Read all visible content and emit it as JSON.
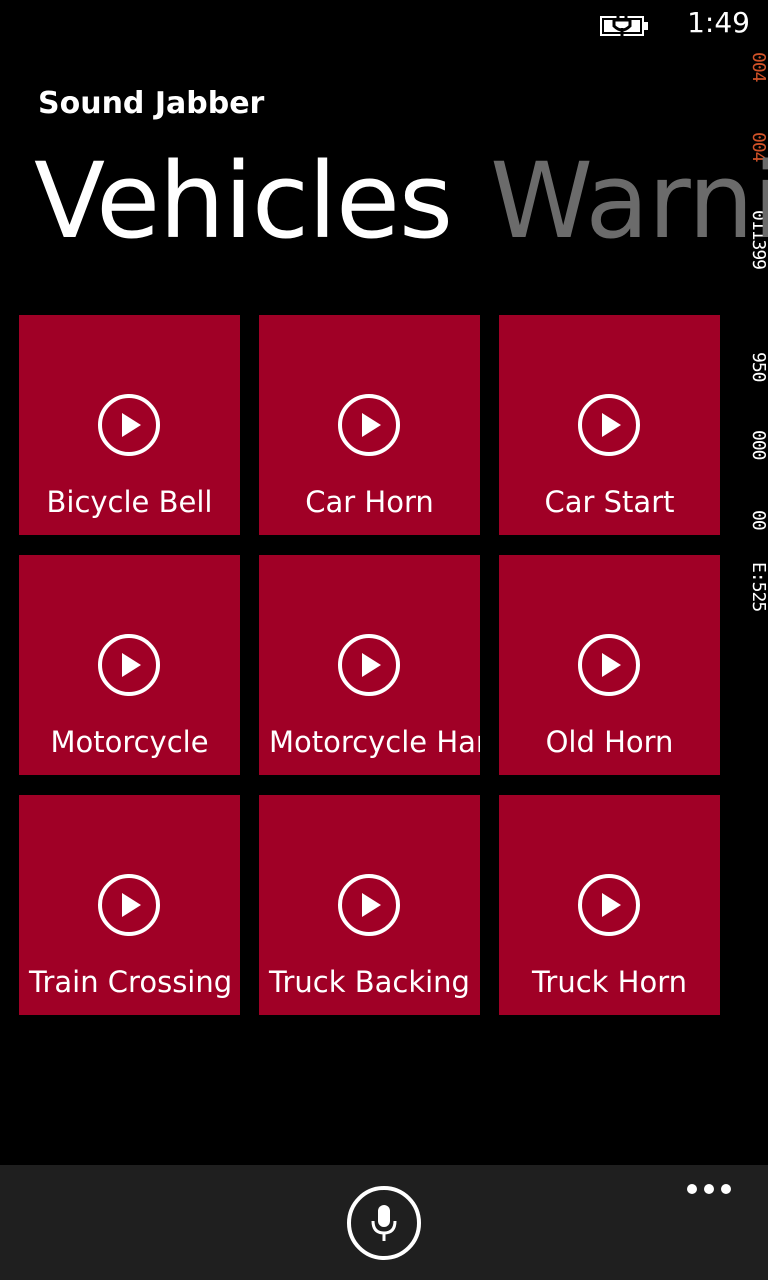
{
  "status": {
    "time": "1:49"
  },
  "counters": [
    {
      "text": "004",
      "color": "#d05228"
    },
    {
      "text": "004",
      "color": "#d05228"
    },
    {
      "text": "011399",
      "color": "#ffffff"
    },
    {
      "text": "950",
      "color": "#ffffff"
    },
    {
      "text": "000",
      "color": "#ffffff"
    },
    {
      "text": "00",
      "color": "#ffffff"
    },
    {
      "text": "E:525",
      "color": "#ffffff"
    }
  ],
  "app": {
    "title": "Sound Jabber"
  },
  "pivot": {
    "active": "Vehicles",
    "next": "Warning"
  },
  "tiles": [
    {
      "label": "Bicycle Bell"
    },
    {
      "label": "Car Horn"
    },
    {
      "label": "Car Start"
    },
    {
      "label": "Motorcycle"
    },
    {
      "label": "Motorcycle Harley"
    },
    {
      "label": "Old Horn"
    },
    {
      "label": "Train Crossing"
    },
    {
      "label": "Truck Backing Up"
    },
    {
      "label": "Truck Horn"
    }
  ],
  "colors": {
    "tile": "#a00026",
    "appbar": "#1f1f1f",
    "pivot_inactive": "#6b6b6b"
  },
  "icons": {
    "play": "play-icon",
    "mic": "microphone-icon",
    "more": "ellipsis-icon"
  }
}
